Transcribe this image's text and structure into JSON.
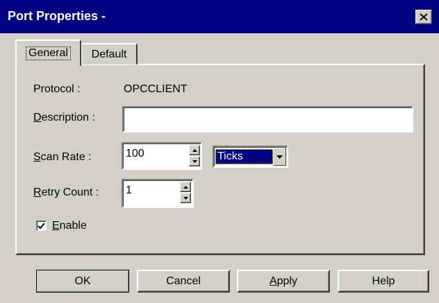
{
  "window": {
    "title": "Port Properties -"
  },
  "tabs": [
    {
      "label": "General"
    },
    {
      "label": "Default"
    }
  ],
  "general": {
    "protocol_label": "Protocol :",
    "protocol_value": "OPCCLIENT",
    "description_label_accel": "D",
    "description_label_rest": "escription :",
    "description_value": "",
    "scan_rate_label_accel": "S",
    "scan_rate_label_rest": "can Rate :",
    "scan_rate_value": "100",
    "scan_unit_value": "Ticks",
    "retry_label_accel": "R",
    "retry_label_rest": "etry Count :",
    "retry_value": "1",
    "enable_label_accel": "E",
    "enable_label_rest": "nable",
    "enable_checked": true
  },
  "buttons": {
    "ok": "OK",
    "cancel": "Cancel",
    "apply_accel": "A",
    "apply_rest": "pply",
    "help": "Help"
  },
  "icons": {
    "close": "close-icon",
    "spin_up": "arrow-up-icon",
    "spin_down": "arrow-down-icon",
    "dropdown": "chevron-down-icon",
    "check": "check-icon"
  },
  "colors": {
    "titlebar": "#000080",
    "face": "#d4d0c8",
    "selection": "#000080"
  }
}
